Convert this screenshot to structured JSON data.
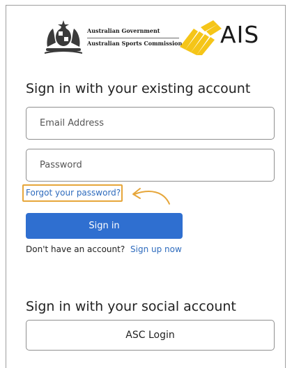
{
  "header": {
    "gov_title": "Australian Government",
    "gov_subtitle": "Australian Sports Commission",
    "brand": "AIS"
  },
  "signin": {
    "heading": "Sign in with your existing account",
    "email_placeholder": "Email Address",
    "password_placeholder": "Password",
    "forgot_label": "Forgot your password?",
    "submit_label": "Sign in",
    "no_account_text": "Don't have an account?",
    "signup_label": "Sign up now"
  },
  "social": {
    "heading": "Sign in with your social account",
    "asc_label": "ASC Login"
  },
  "colors": {
    "primary": "#2f6fd0",
    "link": "#2e6bbd",
    "highlight": "#e6a63a",
    "brand_yellow": "#f5c518"
  }
}
